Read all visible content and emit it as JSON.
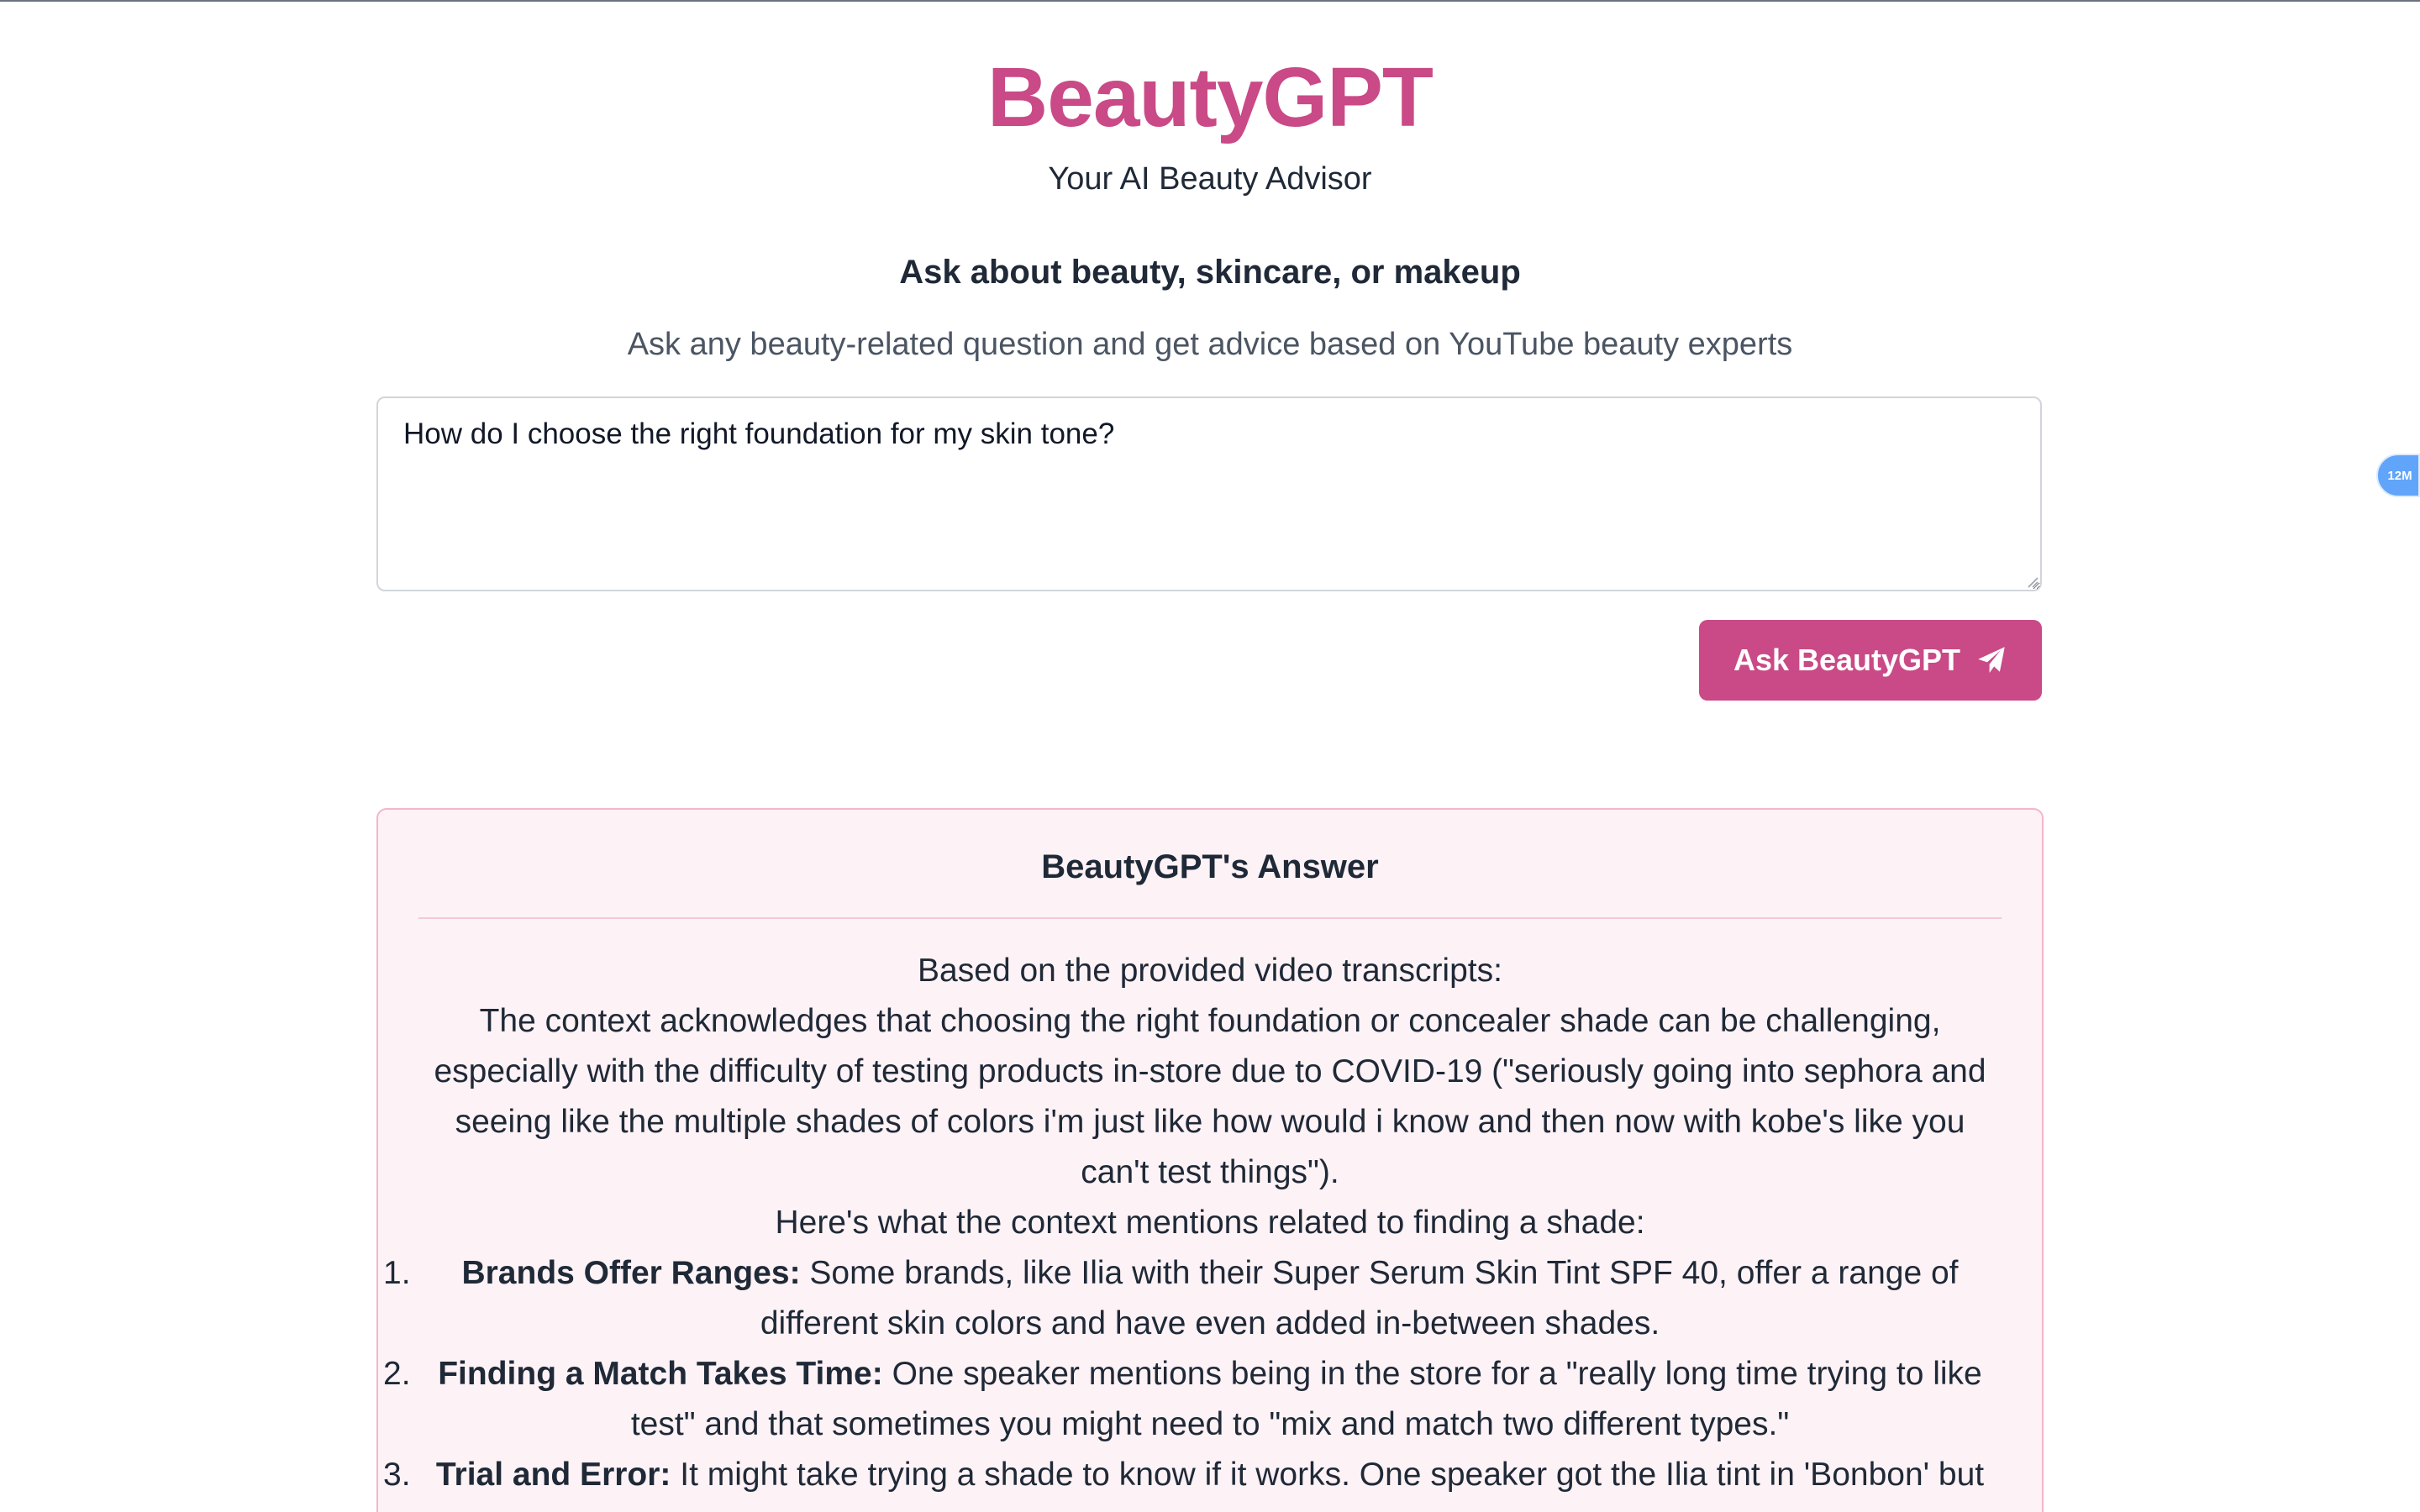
{
  "app": {
    "title": "BeautyGPT",
    "subtitle": "Your AI Beauty Advisor"
  },
  "ask_section": {
    "heading": "Ask about beauty, skincare, or makeup",
    "description": "Ask any beauty-related question and get advice based on YouTube beauty experts",
    "question_value": "How do I choose the right foundation for my skin tone?",
    "button_label": "Ask BeautyGPT",
    "button_icon": "paper-plane-icon"
  },
  "side_badge": {
    "label": "12M",
    "color": "#60a5fa"
  },
  "answer": {
    "title": "BeautyGPT's Answer",
    "intro": "Based on the provided video transcripts:",
    "context": "The context acknowledges that choosing the right foundation or concealer shade can be challenging, especially with the difficulty of testing products in-store due to COVID-19 (\"seriously going into sephora and seeing like the multiple shades of colors i'm just like how would i know and then now with kobe's like you can't test things\").",
    "list_intro": "Here's what the context mentions related to finding a shade:",
    "items": [
      {
        "number": "1.",
        "title": "Brands Offer Ranges:",
        "text": " Some brands, like Ilia with their Super Serum Skin Tint SPF 40, offer a range of different skin colors and have even added in-between shades."
      },
      {
        "number": "2.",
        "title": "Finding a Match Takes Time:",
        "text": " One speaker mentions being in the store for a \"really long time trying to like test\" and that sometimes you might need to \"mix and match two different types.\""
      },
      {
        "number": "3.",
        "title": "Trial and Error:",
        "text": " It might take trying a shade to know if it works. One speaker got the Ilia tint in 'Bonbon' but"
      }
    ]
  },
  "colors": {
    "brand_pink": "#c94a86",
    "answer_bg": "#fdf2f5",
    "answer_border": "#f5b5cb"
  }
}
